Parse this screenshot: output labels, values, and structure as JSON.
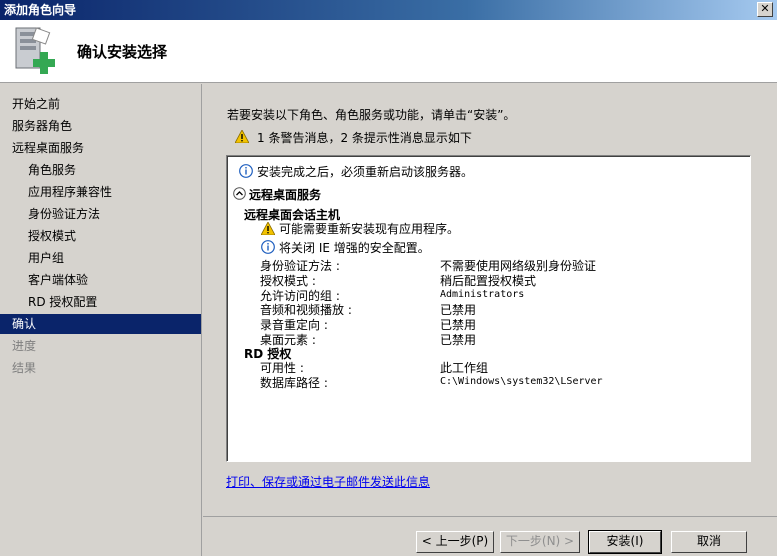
{
  "window": {
    "title": "添加角色向导",
    "close_glyph": "✕"
  },
  "header": {
    "title": "确认安装选择"
  },
  "sidebar": {
    "items": [
      {
        "label": "开始之前"
      },
      {
        "label": "服务器角色"
      },
      {
        "label": "远程桌面服务"
      },
      {
        "label": "角色服务"
      },
      {
        "label": "应用程序兼容性"
      },
      {
        "label": "身份验证方法"
      },
      {
        "label": "授权模式"
      },
      {
        "label": "用户组"
      },
      {
        "label": "客户端体验"
      },
      {
        "label": "RD 授权配置"
      },
      {
        "label": "确认"
      },
      {
        "label": "进度"
      },
      {
        "label": "结果"
      }
    ]
  },
  "main": {
    "intro": "若要安装以下角色、角色服务或功能，请单击“安装”。",
    "warning_summary": "1 条警告消息，2 条提示性消息显示如下",
    "details": {
      "restart_notice": "安装完成之后，必须重新启动该服务器。",
      "section_title": "远程桌面服务",
      "session_host_title": "远程桌面会话主机",
      "reinstall_warning": "可能需要重新安装现有应用程序。",
      "ie_notice": "将关闭 IE 增强的安全配置。",
      "rows": [
        {
          "key": "身份验证方法 :",
          "value": "不需要使用网络级别身份验证"
        },
        {
          "key": "授权模式 :",
          "value": "稍后配置授权模式"
        },
        {
          "key": "允许访问的组 :",
          "value": "Administrators"
        },
        {
          "key": "音频和视频播放 :",
          "value": "已禁用"
        },
        {
          "key": "录音重定向 :",
          "value": "已禁用"
        },
        {
          "key": "桌面元素 :",
          "value": "已禁用"
        }
      ],
      "rd_licensing_title": "RD 授权",
      "rd_rows": [
        {
          "key": "可用性 :",
          "value": "此工作组"
        },
        {
          "key": "数据库路径 :",
          "value": "C:\\Windows\\system32\\LServer"
        }
      ]
    },
    "link": "打印、保存或通过电子邮件发送此信息"
  },
  "footer": {
    "prev": "< 上一步(P)",
    "next": "下一步(N) >",
    "install": "安装(I)",
    "cancel": "取消"
  },
  "colors": {
    "selection": "#0a246a",
    "link": "#0000ee",
    "warning": "#f2c200",
    "info": "#1f5fbf"
  }
}
